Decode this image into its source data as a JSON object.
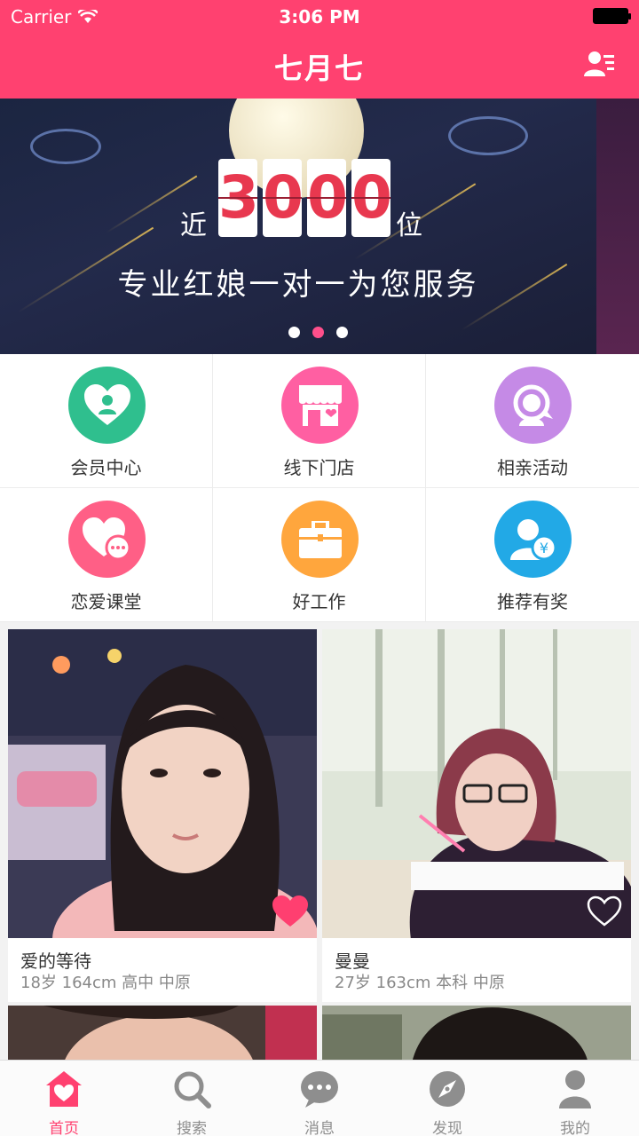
{
  "status_bar": {
    "carrier": "Carrier",
    "time": "3:06 PM"
  },
  "nav": {
    "title": "七月七"
  },
  "banner": {
    "digits": [
      "3",
      "0",
      "0",
      "0"
    ],
    "prefix": "近",
    "suffix": "位",
    "slogan": "专业红娘一对一为您服务"
  },
  "grid": [
    {
      "label": "会员中心",
      "icon": "member-heart-icon",
      "color": "#2fbf8e"
    },
    {
      "label": "线下门店",
      "icon": "store-icon",
      "color": "#ff5fa2"
    },
    {
      "label": "相亲活动",
      "icon": "chat-bubble-person-icon",
      "color": "#c58ae6"
    },
    {
      "label": "恋爱课堂",
      "icon": "heart-chat-icon",
      "color": "#ff5f86"
    },
    {
      "label": "好工作",
      "icon": "briefcase-icon",
      "color": "#ffa63d"
    },
    {
      "label": "推荐有奖",
      "icon": "referral-yen-icon",
      "color": "#22a9e6"
    }
  ],
  "profiles": [
    {
      "name": "爱的等待",
      "info": "18岁 164cm 高中 中原",
      "liked": true
    },
    {
      "name": "曼曼",
      "info": "27岁 163cm 本科 中原",
      "liked": false
    }
  ],
  "tabs": [
    {
      "label": "首页",
      "icon": "home-heart-icon",
      "active": true
    },
    {
      "label": "搜索",
      "icon": "search-icon",
      "active": false
    },
    {
      "label": "消息",
      "icon": "message-icon",
      "active": false
    },
    {
      "label": "发现",
      "icon": "compass-icon",
      "active": false
    },
    {
      "label": "我的",
      "icon": "person-icon",
      "active": false
    }
  ],
  "colors": {
    "brand": "#ff4170",
    "tab_inactive": "#8e8e8e"
  }
}
